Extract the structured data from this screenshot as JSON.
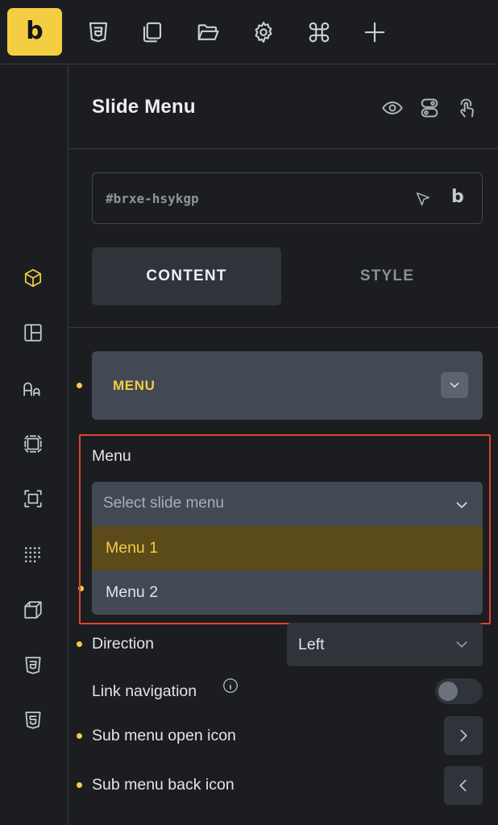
{
  "toolbar": {
    "logo": "b",
    "icons": [
      "css3-icon",
      "copy-icon",
      "folder-open-icon",
      "settings-gear-icon",
      "command-icon",
      "plus-icon"
    ]
  },
  "sidebar": {
    "icons": [
      "cube-icon",
      "layout-icon",
      "typography-icon",
      "frame-icon",
      "selection-icon",
      "dot-grid-icon",
      "box-3d-icon",
      "css3-icon",
      "html5-icon"
    ],
    "active": "cube-icon"
  },
  "panel": {
    "title": "Slide Menu",
    "element_id": "#brxe-hsykgp",
    "id_badge": "b",
    "tabs": {
      "content": "CONTENT",
      "style": "STYLE"
    },
    "group": {
      "label": "MENU"
    },
    "menu_field": {
      "label": "Menu",
      "placeholder": "Select slide menu",
      "options": [
        "Menu 1",
        "Menu 2"
      ]
    },
    "direction": {
      "label": "Direction",
      "value": "Left"
    },
    "link_navigation": {
      "label": "Link navigation",
      "enabled": false
    },
    "sub_menu_open_icon": {
      "label": "Sub menu open icon"
    },
    "sub_menu_back_icon": {
      "label": "Sub menu back icon"
    }
  },
  "colors": {
    "accent": "#f4cd42",
    "background": "#1b1d21",
    "highlight_border": "#e0442e",
    "option_selected_bg": "#5b4a1a"
  }
}
